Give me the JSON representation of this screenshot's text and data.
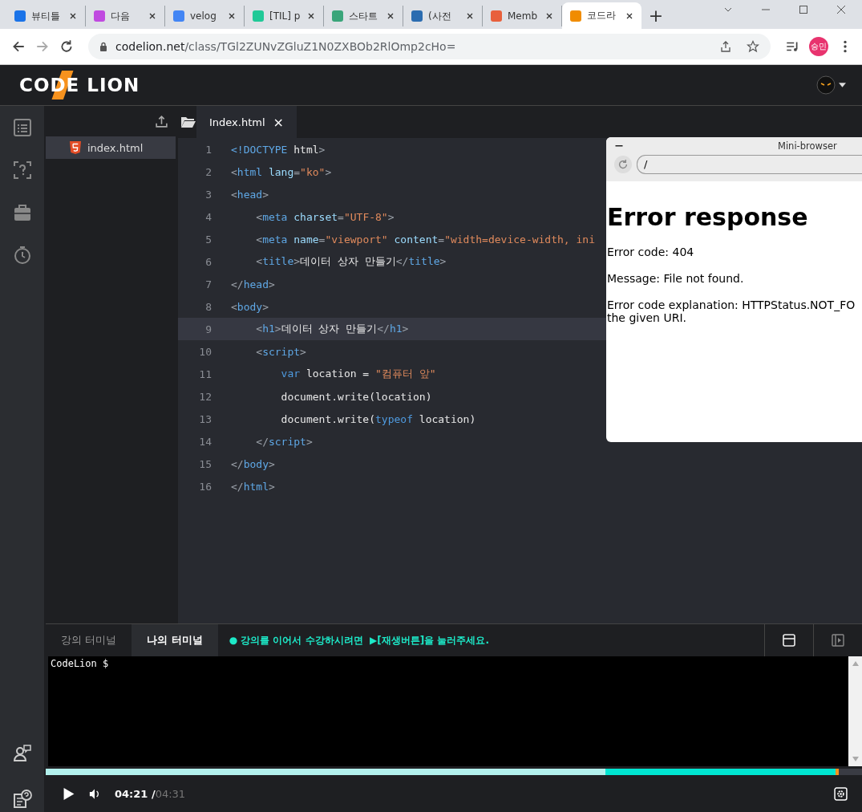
{
  "browser": {
    "tabs": [
      {
        "title": "뷰티틀",
        "color": "#1a73e8",
        "selected": false
      },
      {
        "title": "다음",
        "color": "#c04ae0",
        "selected": false
      },
      {
        "title": "velog",
        "color": "#4285f4",
        "selected": false
      },
      {
        "title": "[TIL] p",
        "color": "#20c997",
        "selected": false
      },
      {
        "title": "스타트",
        "color": "#3aa57a",
        "selected": false
      },
      {
        "title": "(사전",
        "color": "#2b6cb0",
        "selected": false
      },
      {
        "title": "Memb",
        "color": "#e8603c",
        "selected": false
      },
      {
        "title": "코드라",
        "color": "#f08c00",
        "selected": true
      }
    ],
    "new_tab": "+",
    "address": {
      "host": "codelion.net",
      "path": "/class/TGl2ZUNvZGluZ1N0ZXBOb2RlOmp2cHo="
    },
    "profile": "승민"
  },
  "app": {
    "logo": "CODE LION",
    "files": [
      {
        "name": "index.html",
        "selected": true
      }
    ],
    "editor_tab": {
      "name": "Index.html",
      "close": "×"
    },
    "lines": [
      {
        "num": "1",
        "current": false,
        "tokens": [
          {
            "t": "<!DOCTYPE ",
            "kind": "tag"
          },
          {
            "t": "html",
            "kind": "text"
          },
          {
            "t": ">",
            "kind": "bracket"
          }
        ]
      },
      {
        "num": "2",
        "current": false,
        "tokens": [
          {
            "t": "<",
            "kind": "bracket"
          },
          {
            "t": "html ",
            "kind": "tag"
          },
          {
            "t": "lang",
            "kind": "attr"
          },
          {
            "t": "=",
            "kind": "bracket"
          },
          {
            "t": "\"ko\"",
            "kind": "string"
          },
          {
            "t": ">",
            "kind": "bracket"
          }
        ]
      },
      {
        "num": "3",
        "current": false,
        "tokens": [
          {
            "t": "<",
            "kind": "bracket"
          },
          {
            "t": "head",
            "kind": "tag"
          },
          {
            "t": ">",
            "kind": "bracket"
          }
        ]
      },
      {
        "num": "4",
        "current": false,
        "tokens": [
          {
            "t": "    <",
            "kind": "bracket"
          },
          {
            "t": "meta ",
            "kind": "tag"
          },
          {
            "t": "charset",
            "kind": "attr"
          },
          {
            "t": "=",
            "kind": "bracket"
          },
          {
            "t": "\"UTF-8\"",
            "kind": "string"
          },
          {
            "t": ">",
            "kind": "bracket"
          }
        ]
      },
      {
        "num": "5",
        "current": false,
        "tokens": [
          {
            "t": "    <",
            "kind": "bracket"
          },
          {
            "t": "meta ",
            "kind": "tag"
          },
          {
            "t": "name",
            "kind": "attr"
          },
          {
            "t": "=",
            "kind": "bracket"
          },
          {
            "t": "\"viewport\" ",
            "kind": "string"
          },
          {
            "t": "content",
            "kind": "attr"
          },
          {
            "t": "=",
            "kind": "bracket"
          },
          {
            "t": "\"width=device-width, ini",
            "kind": "string"
          }
        ]
      },
      {
        "num": "6",
        "current": false,
        "tokens": [
          {
            "t": "    <",
            "kind": "bracket"
          },
          {
            "t": "title",
            "kind": "tag"
          },
          {
            "t": ">",
            "kind": "bracket"
          },
          {
            "t": "데이터 상자 만들기",
            "kind": "text"
          },
          {
            "t": "</",
            "kind": "bracket"
          },
          {
            "t": "title",
            "kind": "tag"
          },
          {
            "t": ">",
            "kind": "bracket"
          }
        ]
      },
      {
        "num": "7",
        "current": false,
        "tokens": [
          {
            "t": "</",
            "kind": "bracket"
          },
          {
            "t": "head",
            "kind": "tag"
          },
          {
            "t": ">",
            "kind": "bracket"
          }
        ]
      },
      {
        "num": "8",
        "current": false,
        "tokens": [
          {
            "t": "<",
            "kind": "bracket"
          },
          {
            "t": "body",
            "kind": "tag"
          },
          {
            "t": ">",
            "kind": "bracket"
          }
        ]
      },
      {
        "num": "9",
        "current": true,
        "tokens": [
          {
            "t": "    <",
            "kind": "bracket"
          },
          {
            "t": "h1",
            "kind": "tag"
          },
          {
            "t": ">",
            "kind": "bracket"
          },
          {
            "t": "데이터 상자 만들기",
            "kind": "text"
          },
          {
            "t": "</",
            "kind": "bracket"
          },
          {
            "t": "h1",
            "kind": "tag"
          },
          {
            "t": ">",
            "kind": "bracket"
          }
        ]
      },
      {
        "num": "10",
        "current": false,
        "tokens": [
          {
            "t": "    <",
            "kind": "bracket"
          },
          {
            "t": "script",
            "kind": "tag"
          },
          {
            "t": ">",
            "kind": "bracket"
          }
        ]
      },
      {
        "num": "11",
        "current": false,
        "tokens": [
          {
            "t": "        var ",
            "kind": "keyword"
          },
          {
            "t": "location = ",
            "kind": "text"
          },
          {
            "t": "\"컴퓨터 앞\"",
            "kind": "string"
          }
        ]
      },
      {
        "num": "12",
        "current": false,
        "tokens": [
          {
            "t": "        document.write(location)",
            "kind": "text"
          }
        ]
      },
      {
        "num": "13",
        "current": false,
        "tokens": [
          {
            "t": "        document.write(",
            "kind": "text"
          },
          {
            "t": "typeof ",
            "kind": "keyword"
          },
          {
            "t": "location)",
            "kind": "text"
          }
        ]
      },
      {
        "num": "14",
        "current": false,
        "tokens": [
          {
            "t": "    </",
            "kind": "bracket"
          },
          {
            "t": "script",
            "kind": "tag"
          },
          {
            "t": ">",
            "kind": "bracket"
          }
        ]
      },
      {
        "num": "15",
        "current": false,
        "tokens": [
          {
            "t": "</",
            "kind": "bracket"
          },
          {
            "t": "body",
            "kind": "tag"
          },
          {
            "t": ">",
            "kind": "bracket"
          }
        ]
      },
      {
        "num": "16",
        "current": false,
        "tokens": [
          {
            "t": "</",
            "kind": "bracket"
          },
          {
            "t": "html",
            "kind": "tag"
          },
          {
            "t": ">",
            "kind": "bracket"
          }
        ]
      }
    ],
    "mini_browser": {
      "title": "Mini-browser",
      "url": "/",
      "heading": "Error response",
      "paragraphs": [
        [
          "Error code: 404"
        ],
        [
          "Message: File not found."
        ],
        [
          "Error code explanation: HTTPStatus.NOT_FO",
          "the given URI."
        ]
      ]
    },
    "terminal_tabs": [
      {
        "label": "강의 터미널",
        "selected": false
      },
      {
        "label": "나의 터미널",
        "selected": true
      }
    ],
    "notice": "● 강의를 이어서 수강하시려면  ▶[재생버튼]을 눌러주세요.",
    "terminal_text": "CodeLion $",
    "player": {
      "watched": {
        "level": 0.686
      },
      "played": {
        "level": 0.97
      },
      "current": "04:21",
      "separator": "/",
      "total": "04:31"
    }
  }
}
